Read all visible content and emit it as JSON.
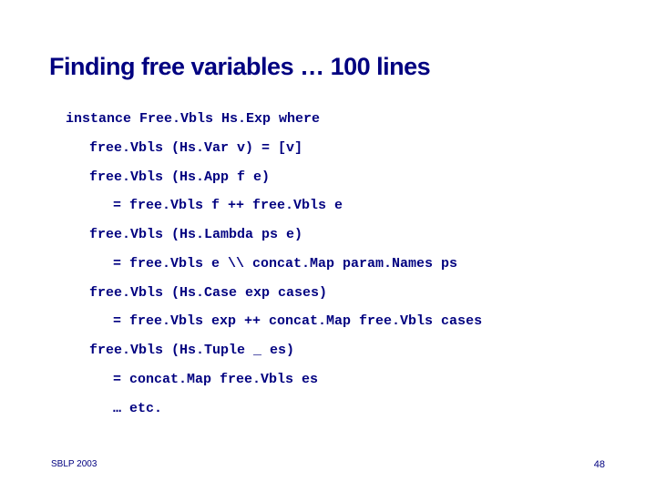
{
  "title": "Finding free variables … 100 lines",
  "code": {
    "l0": "instance Free.Vbls Hs.Exp where",
    "l1": "free.Vbls (Hs.Var v) = [v]",
    "l2": "free.Vbls (Hs.App f e)",
    "l3": "= free.Vbls f ++ free.Vbls e",
    "l4": "free.Vbls (Hs.Lambda ps e)",
    "l5": "= free.Vbls e \\\\ concat.Map param.Names ps",
    "l6": "free.Vbls (Hs.Case exp cases)",
    "l7": "= free.Vbls exp ++ concat.Map free.Vbls cases",
    "l8": "free.Vbls (Hs.Tuple _ es)",
    "l9": "= concat.Map free.Vbls es",
    "l10": "… etc."
  },
  "footer": {
    "left": "SBLP 2003",
    "right": "48"
  }
}
